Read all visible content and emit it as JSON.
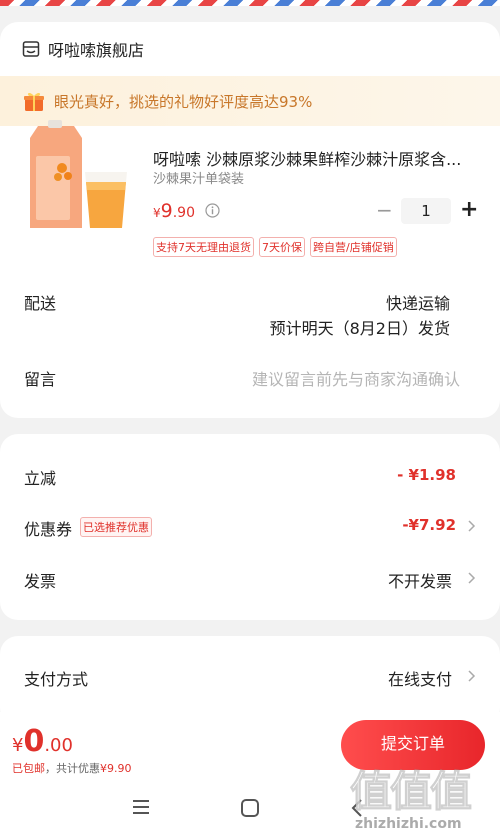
{
  "shop": {
    "icon": "shop-icon",
    "name": "呀啦嗦旗舰店"
  },
  "promo": {
    "icon": "gift-icon",
    "text": "眼光真好，挑选的礼物好评度高达93%"
  },
  "product": {
    "title": "呀啦嗦 沙棘原浆沙棘果鲜榨沙棘汁原浆含...",
    "spec": "沙棘果汁单袋装",
    "price_symbol": "¥",
    "price_int": "9",
    "price_dec": ".90",
    "quantity": "1",
    "minus": "−",
    "plus": "+",
    "tags": [
      "支持7天无理由退货",
      "7天价保",
      "跨自营/店铺促销"
    ]
  },
  "delivery": {
    "label": "配送",
    "method": "快递运输",
    "eta": "预计明天（8月2日）发货"
  },
  "message": {
    "label": "留言",
    "placeholder": "建议留言前先与商家沟通确认"
  },
  "discount": {
    "label": "立减",
    "amount": "- ¥1.98"
  },
  "coupon": {
    "label": "优惠券",
    "tag": "已选推荐优惠",
    "amount": "-¥7.92"
  },
  "invoice": {
    "label": "发票",
    "value": "不开发票"
  },
  "payment": {
    "label": "支付方式",
    "value": "在线支付"
  },
  "bottom": {
    "total_symbol": "¥",
    "total_int": "0",
    "total_dec": ".00",
    "pkg_label": "已包邮",
    "savings_label": "，共计优惠",
    "savings_amount": "¥9.90",
    "submit_label": "提交订单"
  },
  "nav": {
    "menu_icon": "menu-icon",
    "home_icon": "home-icon",
    "back_icon": "back-icon"
  },
  "watermark": {
    "glyphs": "值值值",
    "url": "zhizhizhi.com"
  },
  "colors": {
    "accent": "#e0312b",
    "promo_text": "#c8772a",
    "promo_bg": "#fdf1dc"
  }
}
